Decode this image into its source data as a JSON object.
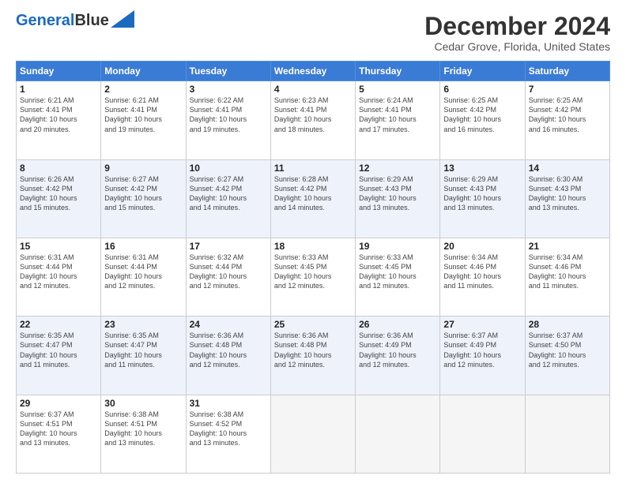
{
  "header": {
    "logo_line1": "General",
    "logo_line2": "Blue",
    "title": "December 2024",
    "subtitle": "Cedar Grove, Florida, United States"
  },
  "weekdays": [
    "Sunday",
    "Monday",
    "Tuesday",
    "Wednesday",
    "Thursday",
    "Friday",
    "Saturday"
  ],
  "weeks": [
    [
      {
        "day": "1",
        "info": "Sunrise: 6:21 AM\nSunset: 4:41 PM\nDaylight: 10 hours\nand 20 minutes."
      },
      {
        "day": "2",
        "info": "Sunrise: 6:21 AM\nSunset: 4:41 PM\nDaylight: 10 hours\nand 19 minutes."
      },
      {
        "day": "3",
        "info": "Sunrise: 6:22 AM\nSunset: 4:41 PM\nDaylight: 10 hours\nand 19 minutes."
      },
      {
        "day": "4",
        "info": "Sunrise: 6:23 AM\nSunset: 4:41 PM\nDaylight: 10 hours\nand 18 minutes."
      },
      {
        "day": "5",
        "info": "Sunrise: 6:24 AM\nSunset: 4:41 PM\nDaylight: 10 hours\nand 17 minutes."
      },
      {
        "day": "6",
        "info": "Sunrise: 6:25 AM\nSunset: 4:42 PM\nDaylight: 10 hours\nand 16 minutes."
      },
      {
        "day": "7",
        "info": "Sunrise: 6:25 AM\nSunset: 4:42 PM\nDaylight: 10 hours\nand 16 minutes."
      }
    ],
    [
      {
        "day": "8",
        "info": "Sunrise: 6:26 AM\nSunset: 4:42 PM\nDaylight: 10 hours\nand 15 minutes."
      },
      {
        "day": "9",
        "info": "Sunrise: 6:27 AM\nSunset: 4:42 PM\nDaylight: 10 hours\nand 15 minutes."
      },
      {
        "day": "10",
        "info": "Sunrise: 6:27 AM\nSunset: 4:42 PM\nDaylight: 10 hours\nand 14 minutes."
      },
      {
        "day": "11",
        "info": "Sunrise: 6:28 AM\nSunset: 4:42 PM\nDaylight: 10 hours\nand 14 minutes."
      },
      {
        "day": "12",
        "info": "Sunrise: 6:29 AM\nSunset: 4:43 PM\nDaylight: 10 hours\nand 13 minutes."
      },
      {
        "day": "13",
        "info": "Sunrise: 6:29 AM\nSunset: 4:43 PM\nDaylight: 10 hours\nand 13 minutes."
      },
      {
        "day": "14",
        "info": "Sunrise: 6:30 AM\nSunset: 4:43 PM\nDaylight: 10 hours\nand 13 minutes."
      }
    ],
    [
      {
        "day": "15",
        "info": "Sunrise: 6:31 AM\nSunset: 4:44 PM\nDaylight: 10 hours\nand 12 minutes."
      },
      {
        "day": "16",
        "info": "Sunrise: 6:31 AM\nSunset: 4:44 PM\nDaylight: 10 hours\nand 12 minutes."
      },
      {
        "day": "17",
        "info": "Sunrise: 6:32 AM\nSunset: 4:44 PM\nDaylight: 10 hours\nand 12 minutes."
      },
      {
        "day": "18",
        "info": "Sunrise: 6:33 AM\nSunset: 4:45 PM\nDaylight: 10 hours\nand 12 minutes."
      },
      {
        "day": "19",
        "info": "Sunrise: 6:33 AM\nSunset: 4:45 PM\nDaylight: 10 hours\nand 12 minutes."
      },
      {
        "day": "20",
        "info": "Sunrise: 6:34 AM\nSunset: 4:46 PM\nDaylight: 10 hours\nand 11 minutes."
      },
      {
        "day": "21",
        "info": "Sunrise: 6:34 AM\nSunset: 4:46 PM\nDaylight: 10 hours\nand 11 minutes."
      }
    ],
    [
      {
        "day": "22",
        "info": "Sunrise: 6:35 AM\nSunset: 4:47 PM\nDaylight: 10 hours\nand 11 minutes."
      },
      {
        "day": "23",
        "info": "Sunrise: 6:35 AM\nSunset: 4:47 PM\nDaylight: 10 hours\nand 11 minutes."
      },
      {
        "day": "24",
        "info": "Sunrise: 6:36 AM\nSunset: 4:48 PM\nDaylight: 10 hours\nand 12 minutes."
      },
      {
        "day": "25",
        "info": "Sunrise: 6:36 AM\nSunset: 4:48 PM\nDaylight: 10 hours\nand 12 minutes."
      },
      {
        "day": "26",
        "info": "Sunrise: 6:36 AM\nSunset: 4:49 PM\nDaylight: 10 hours\nand 12 minutes."
      },
      {
        "day": "27",
        "info": "Sunrise: 6:37 AM\nSunset: 4:49 PM\nDaylight: 10 hours\nand 12 minutes."
      },
      {
        "day": "28",
        "info": "Sunrise: 6:37 AM\nSunset: 4:50 PM\nDaylight: 10 hours\nand 12 minutes."
      }
    ],
    [
      {
        "day": "29",
        "info": "Sunrise: 6:37 AM\nSunset: 4:51 PM\nDaylight: 10 hours\nand 13 minutes."
      },
      {
        "day": "30",
        "info": "Sunrise: 6:38 AM\nSunset: 4:51 PM\nDaylight: 10 hours\nand 13 minutes."
      },
      {
        "day": "31",
        "info": "Sunrise: 6:38 AM\nSunset: 4:52 PM\nDaylight: 10 hours\nand 13 minutes."
      },
      null,
      null,
      null,
      null
    ]
  ]
}
